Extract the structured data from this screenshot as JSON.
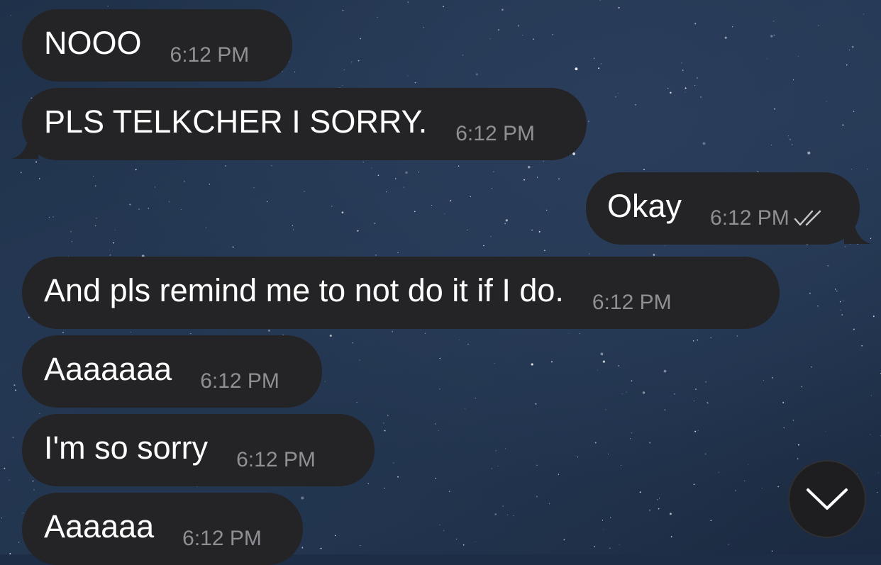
{
  "colors": {
    "bubble_bg": "#242427",
    "message_text": "#ffffff",
    "timestamp_text": "#8f8f94",
    "wallpaper": "#1c2d45"
  },
  "messages": [
    {
      "direction": "incoming",
      "text": "NOOO",
      "time": "6:12 PM"
    },
    {
      "direction": "incoming",
      "text": "PLS TELKCHER I SORRY.",
      "time": "6:12 PM"
    },
    {
      "direction": "outgoing",
      "text": "Okay",
      "time": "6:12 PM",
      "status_icon": "double-check-icon"
    },
    {
      "direction": "incoming",
      "text": "And pls remind me to not do it if I do.",
      "time": "6:12 PM"
    },
    {
      "direction": "incoming",
      "text": "Aaaaaaa",
      "time": "6:12 PM"
    },
    {
      "direction": "incoming",
      "text": "I'm so sorry",
      "time": "6:12 PM"
    },
    {
      "direction": "incoming",
      "text": "Aaaaaa",
      "time": "6:12 PM"
    }
  ],
  "scroll_button": {
    "icon": "chevron-down-icon"
  }
}
